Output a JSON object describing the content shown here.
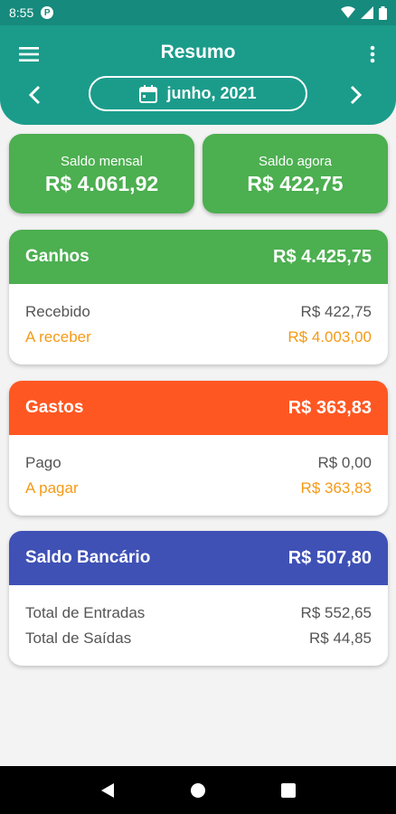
{
  "status_bar": {
    "time": "8:55",
    "app_icon_letter": "P"
  },
  "app_bar": {
    "title": "Resumo",
    "date_label": "junho, 2021"
  },
  "saldo_mensal": {
    "label": "Saldo mensal",
    "value": "R$ 4.061,92"
  },
  "saldo_agora": {
    "label": "Saldo agora",
    "value": "R$ 422,75"
  },
  "ganhos": {
    "title": "Ganhos",
    "total": "R$ 4.425,75",
    "rows": [
      {
        "label": "Recebido",
        "value": "R$ 422,75"
      },
      {
        "label": "A receber",
        "value": "R$ 4.003,00"
      }
    ]
  },
  "gastos": {
    "title": "Gastos",
    "total": "R$ 363,83",
    "rows": [
      {
        "label": "Pago",
        "value": "R$ 0,00"
      },
      {
        "label": "A pagar",
        "value": "R$ 363,83"
      }
    ]
  },
  "saldo_bancario": {
    "title": "Saldo Bancário",
    "total": "R$ 507,80",
    "rows": [
      {
        "label": "Total de Entradas",
        "value": "R$ 552,65"
      },
      {
        "label": "Total de Saídas",
        "value": "R$ 44,85"
      }
    ]
  },
  "colors": {
    "primary": "#1b9c8b",
    "ganhos": "#4caf50",
    "gastos": "#ff5722",
    "saldo_bancario": "#3f51b5",
    "pending": "#f59a16"
  }
}
